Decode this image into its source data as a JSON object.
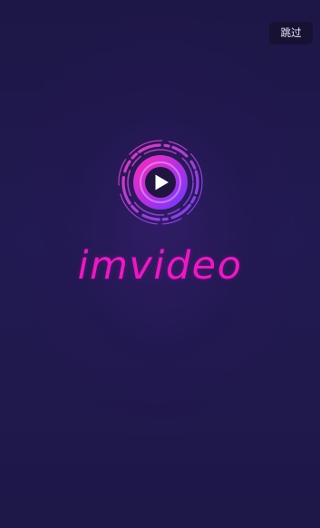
{
  "app": {
    "name": "imvideo"
  },
  "skip": {
    "label": "跳过"
  },
  "logo": {
    "icon": "play-icon"
  },
  "colors": {
    "background": "#1f1849",
    "brand_magenta": "#f016c4",
    "brand_purple": "#7b3dff",
    "skip_button_bg": "#17112f"
  }
}
